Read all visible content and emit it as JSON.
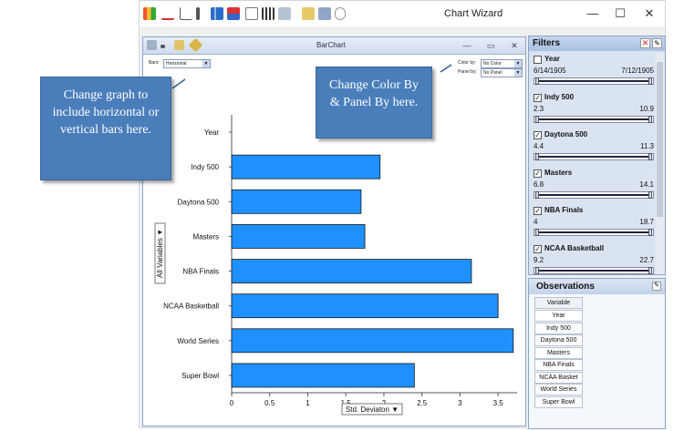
{
  "app": {
    "title": "Chart Wizard",
    "minimize": "—",
    "maximize": "☐",
    "close": "✕"
  },
  "chart_window": {
    "title": "BarChart",
    "bars_label": "Bars:",
    "bars_value": "Horizontal",
    "color_by_label": "Color by:",
    "color_by_value": "No Color",
    "panel_by_label": "Panel by:",
    "panel_by_value": "No Panel"
  },
  "callouts": {
    "bars": "Change graph to include horizontal or vertical bars here.",
    "color": "Change Color By & Panel By here."
  },
  "filters": {
    "title": "Filters",
    "items": [
      {
        "name": "Year",
        "checked": false,
        "min": "6/14/1905",
        "max": "7/12/1905"
      },
      {
        "name": "Indy 500",
        "checked": true,
        "min": "2.3",
        "max": "10.9"
      },
      {
        "name": "Daytona 500",
        "checked": true,
        "min": "4.4",
        "max": "11.3"
      },
      {
        "name": "Masters",
        "checked": true,
        "min": "6.8",
        "max": "14.1"
      },
      {
        "name": "NBA Finals",
        "checked": true,
        "min": "4",
        "max": "18.7"
      },
      {
        "name": "NCAA Basketball",
        "checked": true,
        "min": "9.2",
        "max": "22.7"
      }
    ]
  },
  "observations": {
    "title": "Observations",
    "header": "Variable",
    "rows": [
      "Year",
      "Indy 500",
      "Daytona 500",
      "Masters",
      "NBA Finals",
      "NCAA Basket",
      "World Series",
      "Super Bowl"
    ]
  },
  "chart_data": {
    "type": "bar",
    "orientation": "horizontal",
    "categories": [
      "Year",
      "Indy 500",
      "Daytona 500",
      "Masters",
      "NBA Finals",
      "NCAA Basketball",
      "World Series",
      "Super Bowl"
    ],
    "values": [
      null,
      1.95,
      1.7,
      1.75,
      3.15,
      3.5,
      3.7,
      2.4
    ],
    "xlabel": "Std. Deviaton ▼",
    "ylabel": "All Variables ▼",
    "xlim": [
      0,
      3.75
    ],
    "xticks": [
      "0",
      "0.5",
      "1",
      "1.5",
      "2",
      "2.5",
      "3",
      "3.5"
    ],
    "bar_color": "#1e90ff",
    "grid": false
  }
}
